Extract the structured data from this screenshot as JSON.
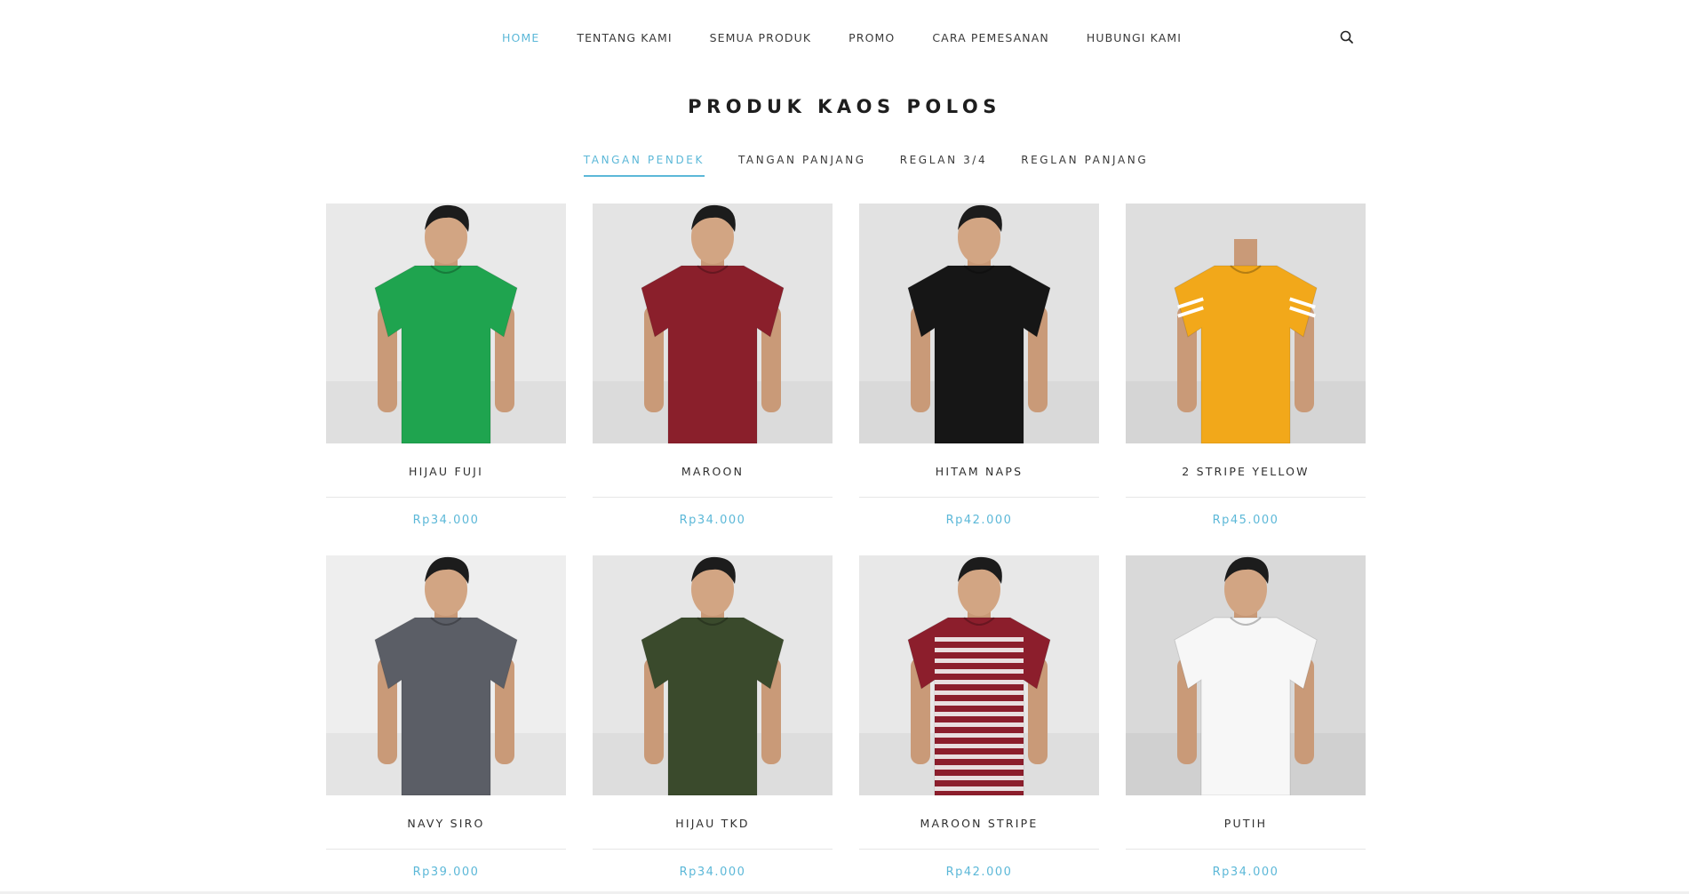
{
  "nav": {
    "items": [
      {
        "label": "HOME",
        "active": true
      },
      {
        "label": "TENTANG KAMI",
        "active": false
      },
      {
        "label": "SEMUA PRODUK",
        "active": false
      },
      {
        "label": "PROMO",
        "active": false
      },
      {
        "label": "CARA PEMESANAN",
        "active": false
      },
      {
        "label": "HUBUNGI KAMI",
        "active": false
      }
    ],
    "search_icon": "search-icon"
  },
  "page_title": "PRODUK KAOS POLOS",
  "tabs": [
    {
      "label": "TANGAN PENDEK",
      "active": true
    },
    {
      "label": "TANGAN PANJANG",
      "active": false
    },
    {
      "label": "REGLAN 3/4",
      "active": false
    },
    {
      "label": "REGLAN PANJANG",
      "active": false
    }
  ],
  "products": [
    {
      "name": "HIJAU FUJI",
      "price": "Rp34.000",
      "shirt_color": "#1fa44f",
      "bg": "#e9e9e9"
    },
    {
      "name": "MAROON",
      "price": "Rp34.000",
      "shirt_color": "#8a1f2b",
      "bg": "#e4e4e4"
    },
    {
      "name": "HITAM NAPS",
      "price": "Rp42.000",
      "shirt_color": "#161616",
      "bg": "#e2e2e2"
    },
    {
      "name": "2 STRIPE YELLOW",
      "price": "Rp45.000",
      "shirt_color": "#f2a81a",
      "bg": "#dedede"
    },
    {
      "name": "NAVY SIRO",
      "price": "Rp39.000",
      "shirt_color": "#5b5e66",
      "bg": "#eeeeee"
    },
    {
      "name": "HIJAU TKD",
      "price": "Rp34.000",
      "shirt_color": "#3a4a2c",
      "bg": "#e6e6e6"
    },
    {
      "name": "MAROON STRIPE",
      "price": "Rp42.000",
      "shirt_color": "#8c1e2c",
      "bg": "#e8e8e8"
    },
    {
      "name": "PUTIH",
      "price": "Rp34.000",
      "shirt_color": "#f7f7f7",
      "bg": "#d9d9d9"
    }
  ],
  "colors": {
    "accent": "#5cb8d8",
    "text": "#333333"
  }
}
